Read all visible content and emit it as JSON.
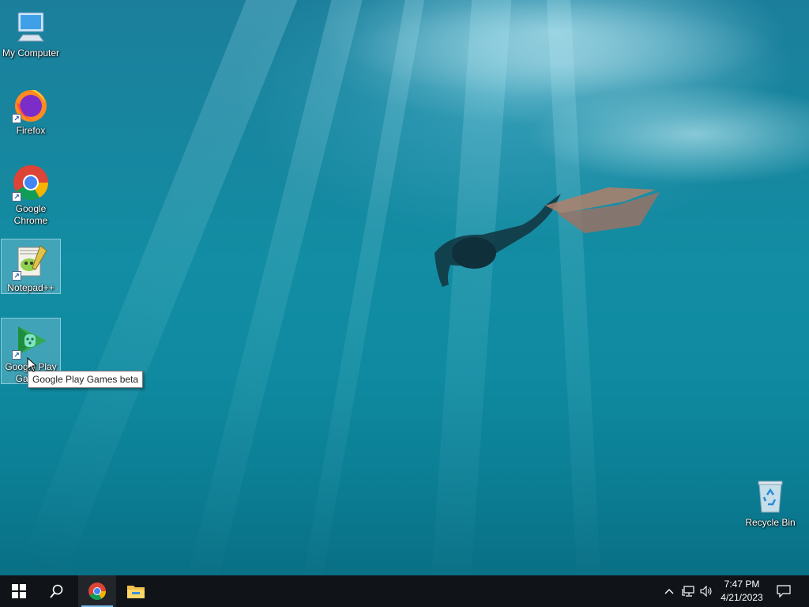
{
  "desktop": {
    "icons": [
      {
        "label": "My Computer",
        "icon": "computer-icon"
      },
      {
        "label": "Firefox",
        "icon": "firefox-icon"
      },
      {
        "label": "Google Chrome",
        "icon": "chrome-icon"
      },
      {
        "label": "Notepad++",
        "icon": "notepad-plus-plus-icon"
      },
      {
        "label": "Google Play Games beta",
        "icon": "google-play-games-icon"
      },
      {
        "label": "Recycle Bin",
        "icon": "recycle-bin-icon"
      }
    ],
    "icon_labels": {
      "my_computer": "My Computer",
      "firefox": "Firefox",
      "chrome_line1": "Google",
      "chrome_line2": "Chrome",
      "notepad": "Notepad++",
      "play_line1": "Google Play",
      "play_line2": "Games",
      "recycle": "Recycle Bin"
    },
    "tooltip": "Google Play Games beta"
  },
  "taskbar": {
    "start_icon": "windows-start-icon",
    "search_icon": "search-icon",
    "pinned": [
      "chrome-icon",
      "file-explorer-icon"
    ],
    "tray_icons": [
      "chevron-up-icon",
      "network-icon",
      "volume-icon"
    ],
    "time": "7:47 PM",
    "date": "4/21/2023",
    "notification_icon": "notification-center-icon"
  },
  "colors": {
    "taskbar": "#101318",
    "accent": "#76b9ed",
    "water": "#128da3"
  }
}
